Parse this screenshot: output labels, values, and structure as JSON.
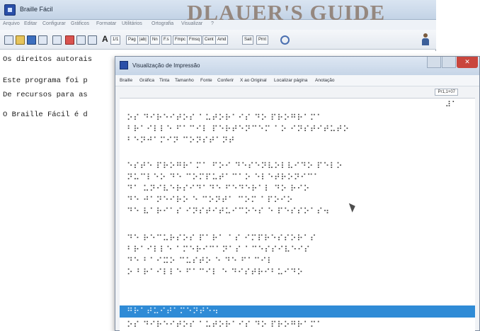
{
  "main_window": {
    "title": "Braille Fácil",
    "brand": "DLAUER'S GUIDE",
    "menu": [
      "Arquivo",
      "Editar",
      "Configurar",
      "Gráficos",
      "Formatar",
      "Utilitários",
      "Ortografia",
      "Visualizar",
      "?"
    ],
    "toolbar": {
      "font_button": "A",
      "page_num_button": "1/1",
      "text_buttons": [
        "Pag",
        "|ab|",
        "Nn",
        "F.s",
        "Fmpc",
        "Fmsq",
        "Cent",
        "Amd",
        "Sait",
        "Prnt"
      ]
    },
    "editor_lines": [
      "Os direitos autorais",
      "Este programa foi p",
      "De recursos para as",
      "O Braille Fácil é d"
    ]
  },
  "preview_window": {
    "title": "Visualização de Impressão",
    "menu": [
      "Braille",
      "Gráfica",
      "Tinta",
      "Tamanho",
      "Fonte",
      "Conferir",
      "X ao Original",
      "Localizar página",
      "Anotação"
    ],
    "zoom": "Pr1,1+07",
    "page_number": "⠼⠁",
    "braille_lines": [
      "⠕⠎ ⠙⠊⠗⠑⠊⠞⠕⠎ ⠁⠥⠞⠕⠗⠁⠊⠎ ⠙⠕ ⠏⠗⠕⠛⠗⠁⠍⠁",
      "⠃⠗⠁⠊⠇⠇⠑ ⠋⠁⠉⠊⠇ ⠏⠑⠗⠞⠑⠝⠉⠑⠍ ⠁⠕ ⠊⠝⠎⠞⠊⠞⠥⠞⠕",
      "⠃⠑⠝⠚⠁⠍⠊⠝ ⠉⠕⠝⠎⠞⠁⠝⠞",
      "⠑⠎⠞⠑ ⠏⠗⠕⠛⠗⠁⠍⠁ ⠋⠕⠊ ⠙⠑⠎⠑⠝⠧⠕⠇⠧⠊⠙⠕ ⠏⠑⠇⠕",
      "⠝⠥⠉⠇⠑⠕ ⠙⠑ ⠉⠕⠍⠏⠥⠞⠁⠉⠁⠕ ⠑⠇⠑⠞⠗⠕⠝⠊⠉⠁",
      "⠙⠁ ⠥⠝⠊⠧⠑⠗⠎⠊⠙⠁⠙⠑ ⠋⠑⠙⠑⠗⠁⠇ ⠙⠕ ⠗⠊⠕",
      "⠙⠑ ⠚⠁⠝⠑⠊⠗⠕ ⠑ ⠉⠕⠝⠞⠁ ⠉⠕⠍ ⠁⠏⠕⠊⠕",
      "⠙⠑ ⠧⠁⠗⠊⠁⠎ ⠊⠝⠎⠞⠊⠞⠥⠊⠉⠕⠑⠎ ⠑ ⠏⠑⠎⠎⠕⠁⠎⠲",
      "⠙⠑ ⠗⠑⠉⠥⠗⠎⠕⠎ ⠏⠁⠗⠁ ⠁⠎ ⠊⠍⠏⠗⠑⠎⠎⠕⠗⠁⠎",
      "⠃⠗⠁⠊⠇⠇⠑ ⠁⠍⠑⠗⠊⠉⠁⠝⠁⠎ ⠁⠉⠑⠎⠎⠊⠧⠑⠊⠎",
      "⠙⠑ ⠃⠁⠊⠭⠕ ⠉⠥⠎⠞⠕ ⠑ ⠙⠑ ⠋⠁⠉⠊⠇",
      "⠕ ⠃⠗⠁⠊⠇⠇⠑ ⠋⠁⠉⠊⠇ ⠑ ⠙⠊⠎⠞⠗⠊⠃⠥⠊⠙⠕",
      "⠛⠗⠁⠞⠥⠊⠞⠁⠍⠑⠝⠞⠑⠲"
    ]
  },
  "colors": {
    "highlight": "#2f8bd6",
    "title_gradient": "#c6d5e7",
    "close_button": "#c9463d"
  }
}
